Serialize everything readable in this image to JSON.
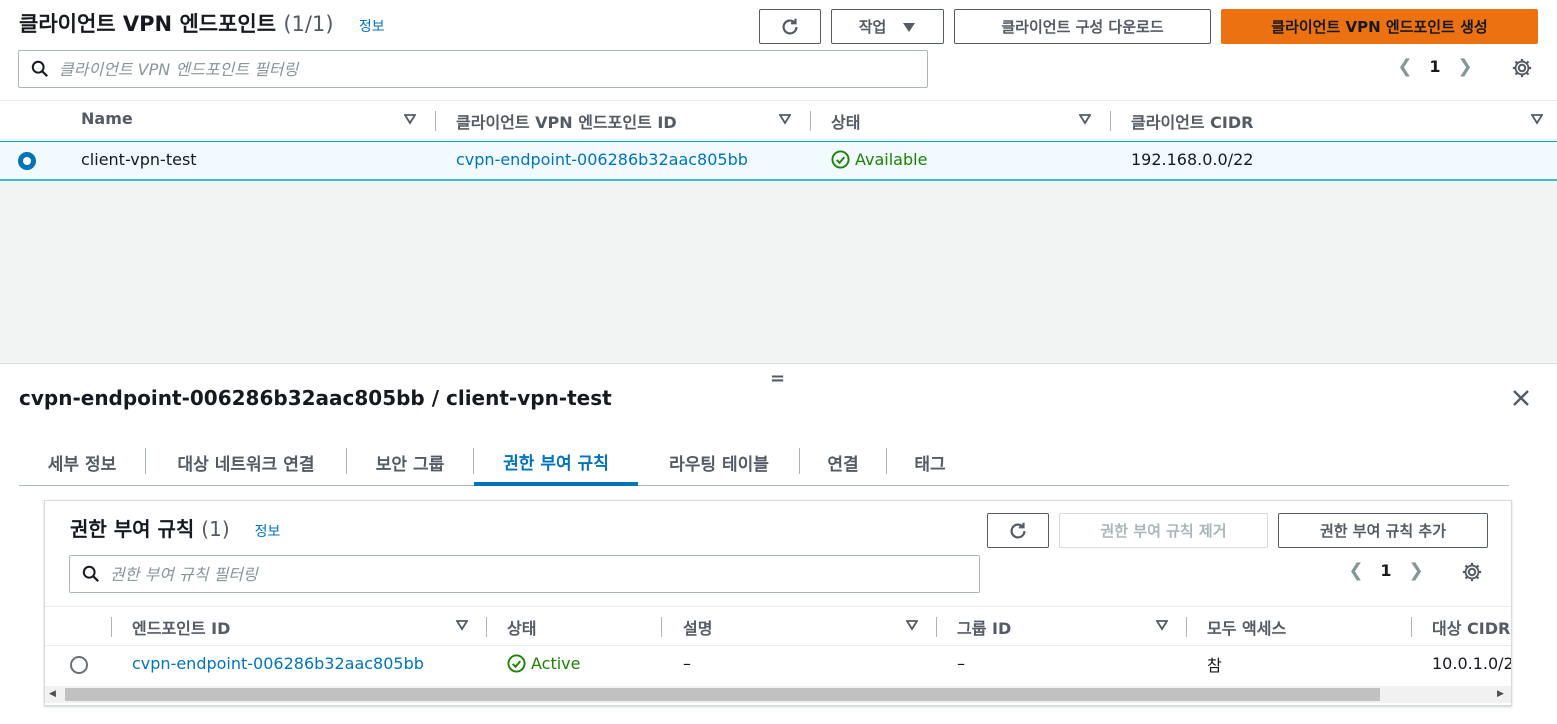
{
  "top": {
    "title": "클라이언트 VPN 엔드포인트",
    "count": "(1/1)",
    "info": "정보",
    "actions_label": "작업",
    "download_label": "클라이언트 구성 다운로드",
    "create_label": "클라이언트 VPN 엔드포인트 생성",
    "search_placeholder": "클라이언트 VPN 엔드포인트 필터링",
    "page": "1",
    "columns": [
      "Name",
      "클라이언트 VPN 엔드포인트 ID",
      "상태",
      "클라이언트 CIDR"
    ],
    "row": {
      "name": "client-vpn-test",
      "endpoint_id": "cvpn-endpoint-006286b32aac805bb",
      "status": "Available",
      "cidr": "192.168.0.0/22"
    }
  },
  "panel": {
    "drag": "=",
    "title": "cvpn-endpoint-006286b32aac805bb / client-vpn-test",
    "tabs": [
      "세부 정보",
      "대상 네트워크 연결",
      "보안 그룹",
      "권한 부여 규칙",
      "라우팅 테이블",
      "연결",
      "태그"
    ],
    "active_tab": "권한 부여 규칙"
  },
  "auth": {
    "title": "권한 부여 규칙",
    "count": "(1)",
    "info": "정보",
    "remove_label": "권한 부여 규칙 제거",
    "add_label": "권한 부여 규칙 추가",
    "search_placeholder": "권한 부여 규칙 필터링",
    "page": "1",
    "columns": [
      "엔드포인트 ID",
      "상태",
      "설명",
      "그룹 ID",
      "모두 액세스",
      "대상 CIDR"
    ],
    "row": {
      "endpoint_id": "cvpn-endpoint-006286b32aac805bb",
      "status": "Active",
      "description": "–",
      "group_id": "–",
      "all_access": "참",
      "cidr": "10.0.1.0/2"
    }
  },
  "colors": {
    "primary": "#ec7211",
    "link": "#0073bb",
    "success": "#1d8102",
    "selected_row": "#f1faff"
  }
}
